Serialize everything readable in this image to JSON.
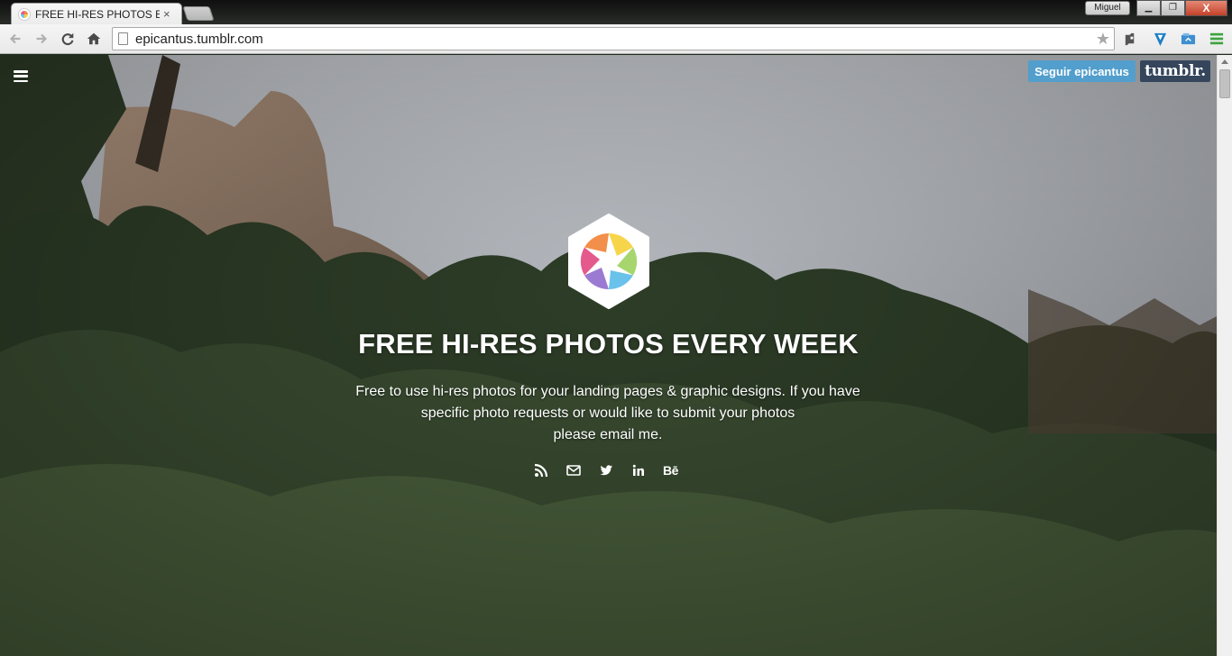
{
  "browser": {
    "tab": {
      "title": "FREE HI-RES PHOTOS EVE",
      "close": "×"
    },
    "profile_name": "Miguel",
    "window_buttons": {
      "minimize": "▁",
      "maximize": "❐",
      "close": "X"
    },
    "address": {
      "url": "epicantus.tumblr.com"
    },
    "icons": {
      "back": "back-arrow-icon",
      "forward": "forward-arrow-icon",
      "reload": "reload-icon",
      "home": "home-icon",
      "bookmark": "star-icon",
      "menu": "hamburger-menu-icon"
    }
  },
  "page": {
    "follow_button": "Seguir epicantus",
    "tumblr_button": "tumblr.",
    "headline": "FREE HI-RES PHOTOS EVERY WEEK",
    "description_lines": [
      "Free to use hi-res photos for your landing pages & graphic designs. If you have",
      "specific photo requests or would like to submit your photos",
      "please email me."
    ],
    "social": {
      "rss": "rss-icon",
      "email": "envelope-icon",
      "twitter": "twitter-icon",
      "linkedin": "in",
      "behance": "Bē"
    }
  },
  "colors": {
    "follow_blue": "#529ecc",
    "tumblr_navy": "#35465c",
    "window_close_red": "#c5412a"
  }
}
